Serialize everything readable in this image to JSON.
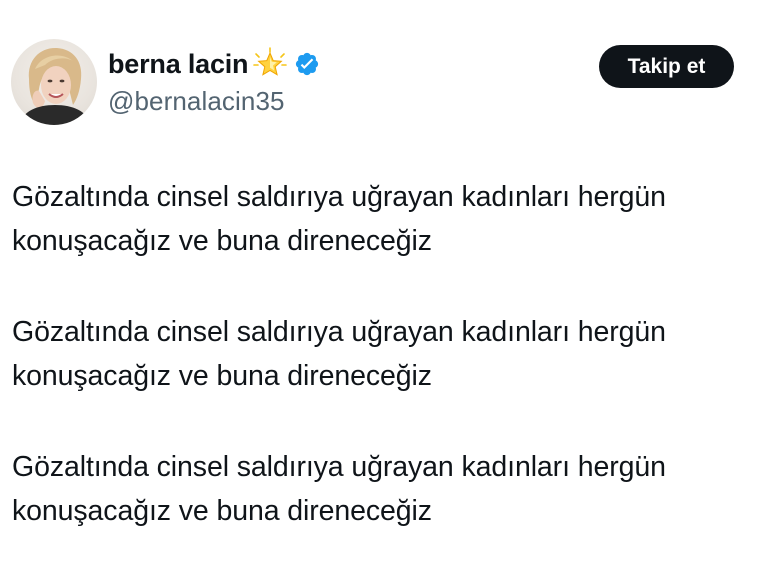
{
  "author": {
    "display_name": "berna lacin",
    "handle": "@bernalacin35",
    "name_emoji": "star-glowing-icon",
    "verified": true,
    "verified_color": "#1d9bf0"
  },
  "actions": {
    "follow_label": "Takip et"
  },
  "tweet": {
    "paragraphs": [
      "Gözaltında cinsel saldırıya uğrayan kadınları hergün konuşacağız ve buna direneceğiz",
      "Gözaltında cinsel saldırıya uğrayan kadınları hergün konuşacağız ve buna direneceğiz",
      "Gözaltında cinsel saldırıya uğrayan kadınları hergün konuşacağız ve buna direneceğiz"
    ]
  },
  "colors": {
    "text": "#0f1419",
    "secondary_text": "#536471",
    "button_bg": "#0f1419",
    "button_text": "#ffffff"
  }
}
